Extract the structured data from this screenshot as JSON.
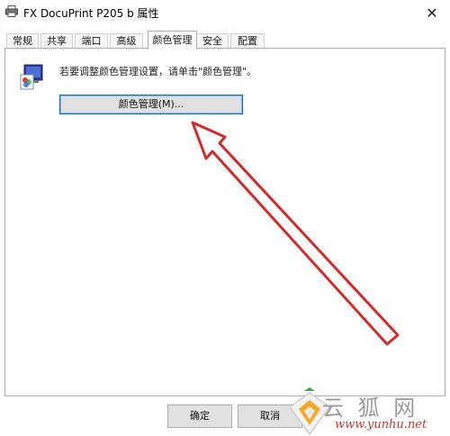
{
  "window": {
    "title": "FX DocuPrint P205 b 属性",
    "close_glyph": "✕"
  },
  "tabs": [
    {
      "label": "常规",
      "active": false
    },
    {
      "label": "共享",
      "active": false
    },
    {
      "label": "端口",
      "active": false
    },
    {
      "label": "高级",
      "active": false
    },
    {
      "label": "颜色管理",
      "active": true
    },
    {
      "label": "安全",
      "active": false
    },
    {
      "label": "配置",
      "active": false
    }
  ],
  "panel": {
    "icon": "color-management-icon",
    "instruction": "若要调整颜色管理设置，请单击\"颜色管理\"。",
    "color_button_label": "颜色管理(M)..."
  },
  "footer": {
    "ok_label": "确定",
    "cancel_label": "取消"
  },
  "annotation": {
    "arrow_color": "#d42a2a"
  },
  "watermark": {
    "logo": "yunhu-logo",
    "glyphs": "云 狐 网",
    "url": "www.yunhu.net"
  }
}
